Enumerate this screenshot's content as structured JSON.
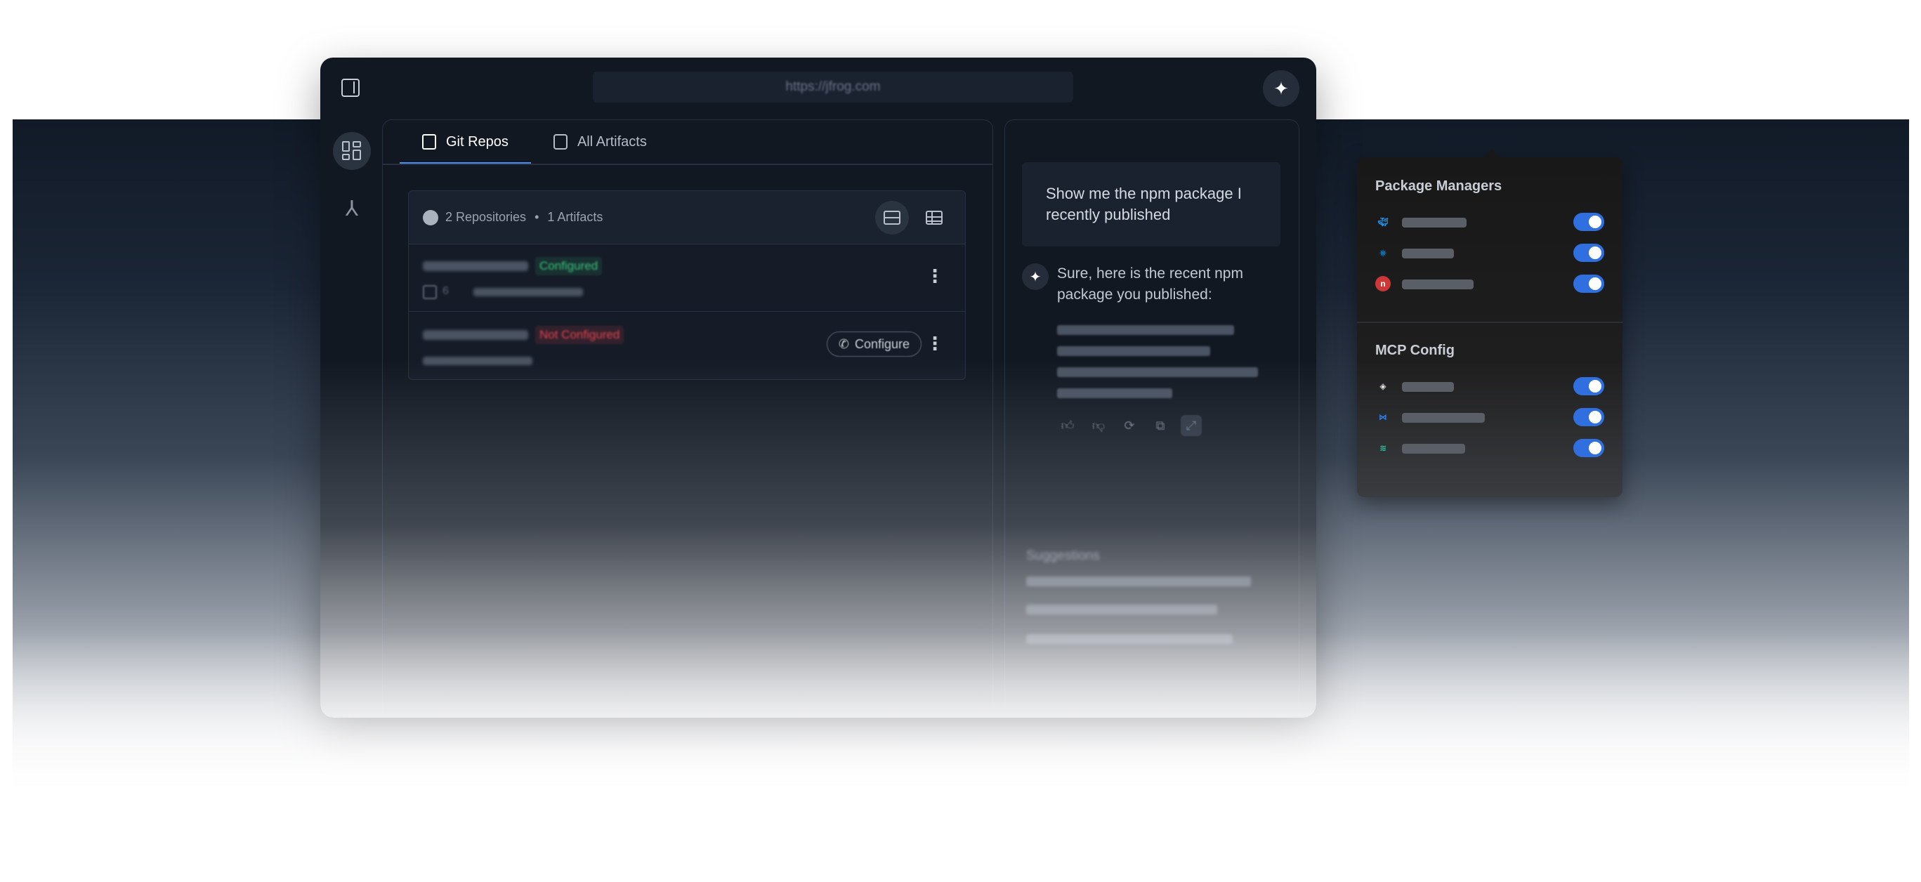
{
  "window": {
    "url": "https://jfrog.com"
  },
  "tabs": [
    {
      "label": "Git Repos"
    },
    {
      "label": "All Artifacts"
    }
  ],
  "repos": {
    "repositories_label": "2 Repositories",
    "separator": "•",
    "artifacts_label": "1 Artifacts",
    "rows": [
      {
        "status": "Configured",
        "meta_count": "6"
      },
      {
        "status": "Not Configured",
        "action": "Configure"
      }
    ]
  },
  "chat": {
    "user_message": "Show me the npm package I recently published",
    "assistant_message": "Sure, here is the recent npm package you published:",
    "suggestions_title": "Suggestions"
  },
  "popover": {
    "package_managers_title": "Package Managers",
    "mcp_config_title": "MCP Config",
    "package_managers": [
      {
        "icon": "docker-icon",
        "enabled": true,
        "color": "#2496ed"
      },
      {
        "icon": "helm-icon",
        "enabled": true,
        "color": "#0f74b8"
      },
      {
        "icon": "npm-icon",
        "enabled": true,
        "color": "#cb3837"
      }
    ],
    "mcp_configs": [
      {
        "icon": "cursor-icon",
        "enabled": true,
        "color": "#e8e8e8"
      },
      {
        "icon": "vscode-icon",
        "enabled": true,
        "color": "#2f80ed"
      },
      {
        "icon": "windsurf-icon",
        "enabled": true,
        "color": "#2ec4a0"
      }
    ]
  },
  "colors": {
    "accent": "#4d8ef0",
    "toggle_on": "#2f6fe0",
    "configured": "#37c47a",
    "not_configured": "#e0424f"
  }
}
